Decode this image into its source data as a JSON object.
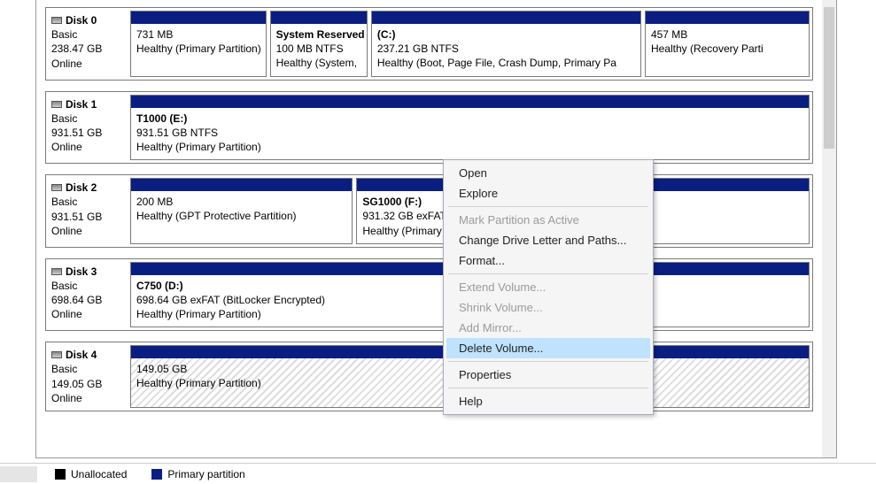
{
  "disks": [
    {
      "name": "Disk 0",
      "type": "Basic",
      "size": "238.47 GB",
      "status": "Online",
      "parts": [
        {
          "title": "",
          "size": "731 MB",
          "status": "Healthy (Primary Partition)",
          "flex": 140
        },
        {
          "title": "System Reserved",
          "size": "100 MB NTFS",
          "status": "Healthy (System,",
          "flex": 100
        },
        {
          "title": "(C:)",
          "size": "237.21 GB NTFS",
          "status": "Healthy (Boot, Page File, Crash Dump, Primary Pa",
          "flex": 280
        },
        {
          "title": "",
          "size": "457 MB",
          "status": "Healthy (Recovery Parti",
          "flex": 170
        }
      ]
    },
    {
      "name": "Disk 1",
      "type": "Basic",
      "size": "931.51 GB",
      "status": "Online",
      "parts": [
        {
          "title": "T1000  (E:)",
          "size": "931.51 GB NTFS",
          "status": "Healthy (Primary Partition)",
          "flex": 700
        }
      ]
    },
    {
      "name": "Disk 2",
      "type": "Basic",
      "size": "931.51 GB",
      "status": "Online",
      "parts": [
        {
          "title": "",
          "size": "200 MB",
          "status": "Healthy (GPT Protective Partition)",
          "flex": 230
        },
        {
          "title": "SG1000  (F:)",
          "size": "931.32 GB exFAT",
          "status": "Healthy (Primary Par",
          "flex": 470
        }
      ]
    },
    {
      "name": "Disk 3",
      "type": "Basic",
      "size": "698.64 GB",
      "status": "Online",
      "parts": [
        {
          "title": "C750  (D:)",
          "size": "698.64 GB exFAT (BitLocker Encrypted)",
          "status": "Healthy (Primary Partition)",
          "flex": 700
        }
      ]
    },
    {
      "name": "Disk 4",
      "type": "Basic",
      "size": "149.05 GB",
      "status": "Online",
      "parts": [
        {
          "title": "",
          "size": "149.05 GB",
          "status": "Healthy (Primary Partition)",
          "flex": 700,
          "hatched": true
        }
      ]
    }
  ],
  "legend": {
    "unallocated": "Unallocated",
    "primary": "Primary partition"
  },
  "context_menu": {
    "open": "Open",
    "explore": "Explore",
    "mark_active": "Mark Partition as Active",
    "change_letter": "Change Drive Letter and Paths...",
    "format": "Format...",
    "extend": "Extend Volume...",
    "shrink": "Shrink Volume...",
    "add_mirror": "Add Mirror...",
    "delete": "Delete Volume...",
    "properties": "Properties",
    "help": "Help"
  }
}
